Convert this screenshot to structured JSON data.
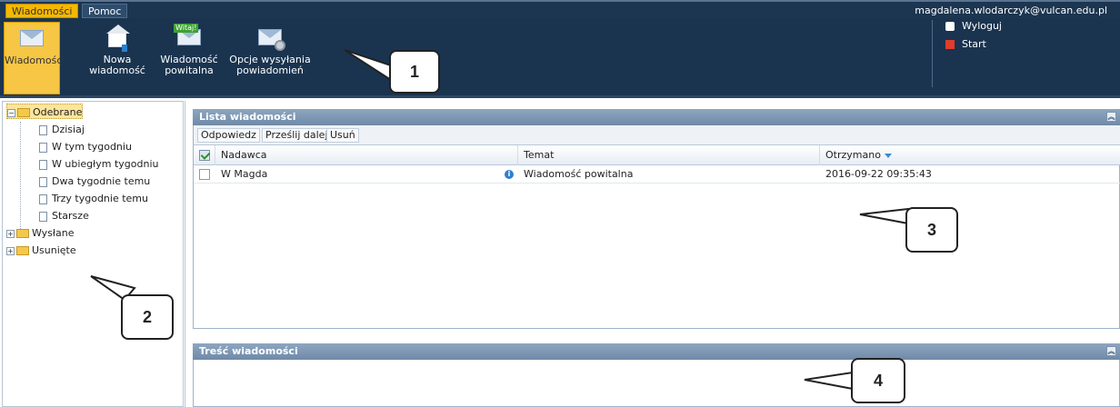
{
  "top_tabs": {
    "messages": "Wiadomości",
    "help": "Pomoc"
  },
  "user": {
    "email": "magdalena.wlodarczyk@vulcan.edu.pl"
  },
  "ribbon": {
    "messages": "Wiadomości",
    "new_message_line1": "Nowa",
    "new_message_line2": "wiadomość",
    "welcome_line1": "Wiadomość",
    "welcome_line2": "powitalna",
    "welcome_badge": "Witaj!",
    "notify_line1": "Opcje wysyłania",
    "notify_line2": "powiadomień",
    "logout": "Wyloguj",
    "start": "Start"
  },
  "sidebar": {
    "received": "Odebrane",
    "today": "Dzisiaj",
    "this_week": "W tym tygodniu",
    "last_week": "W ubiegłym tygodniu",
    "two_weeks": "Dwa tygodnie temu",
    "three_weeks": "Trzy tygodnie temu",
    "older": "Starsze",
    "sent": "Wysłane",
    "deleted": "Usunięte"
  },
  "message_list": {
    "title": "Lista wiadomości",
    "reply": "Odpowiedz",
    "forward": "Prześlij dalej",
    "delete": "Usuń",
    "col_sender": "Nadawca",
    "col_subject": "Temat",
    "col_received": "Otrzymano",
    "rows": [
      {
        "sender": "W Magda",
        "subject": "Wiadomość powitalna",
        "received": "2016-09-22 09:35:43"
      }
    ]
  },
  "message_content": {
    "title": "Treść wiadomości"
  },
  "callouts": {
    "c1": "1",
    "c2": "2",
    "c3": "3",
    "c4": "4"
  }
}
